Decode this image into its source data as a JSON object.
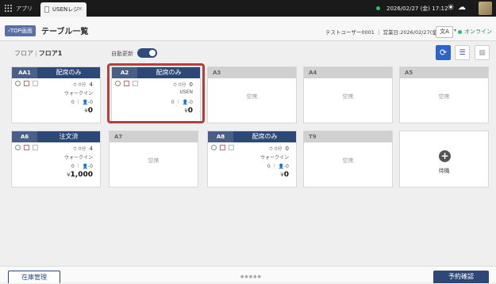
{
  "tabbar": {
    "app_label": "アプリ",
    "tab_title": "USENレジ",
    "tab_close": "×",
    "datetime": "2026/02/27 (金) 17:12",
    "sun": "☀",
    "cloud": "☁"
  },
  "header": {
    "top_button": "TOP画面",
    "title": "テーブル一覧",
    "user_info": "テストユーザー0001 ｜ 営業日:2026/02/27(金)",
    "lang": "文A",
    "online": "オンライン"
  },
  "toolbar": {
    "floor_root": "フロア",
    "floor_sep": "|",
    "floor_current": "フロア1",
    "auto_update": "自動更新",
    "auto_update_on": true,
    "refresh_icon": "⟳",
    "list_icon": "☰",
    "grid_icon": "▦"
  },
  "tables": [
    {
      "name": "AA1",
      "status": "配席のみ",
      "time": "0分",
      "time_val": "4",
      "walkin": "ウォークイン",
      "guests": "0 ｜ 👤-0",
      "amount_prefix": "¥",
      "amount": "0"
    },
    {
      "name": "A2",
      "status": "配席のみ",
      "time": "0分",
      "time_val": "0",
      "walkin": "USEN",
      "guests": "0 ｜ 👤-0",
      "amount_prefix": "¥",
      "amount": "0"
    },
    {
      "name": "A3",
      "empty": "空席"
    },
    {
      "name": "A4",
      "empty": "空席"
    },
    {
      "name": "A5",
      "empty": "空席"
    },
    {
      "name": "A6",
      "status": "注文済",
      "time": "0分",
      "time_val": "4",
      "walkin": "ウォークイン",
      "guests": "0 ｜ 👤-0",
      "amount_prefix": "¥",
      "amount": "1,000"
    },
    {
      "name": "A7",
      "empty": "空席"
    },
    {
      "name": "A8",
      "status": "配席のみ",
      "time": "0分",
      "time_val": "0",
      "walkin": "ウォークイン",
      "guests": "0 ｜ 👤-0",
      "amount_prefix": "¥",
      "amount": "0"
    },
    {
      "name": "T9",
      "empty": "空席"
    }
  ],
  "add_card": {
    "label": "待機"
  },
  "footer": {
    "stock": "在庫管理",
    "reservation": "予約確認",
    "dots": "●●●●●"
  }
}
